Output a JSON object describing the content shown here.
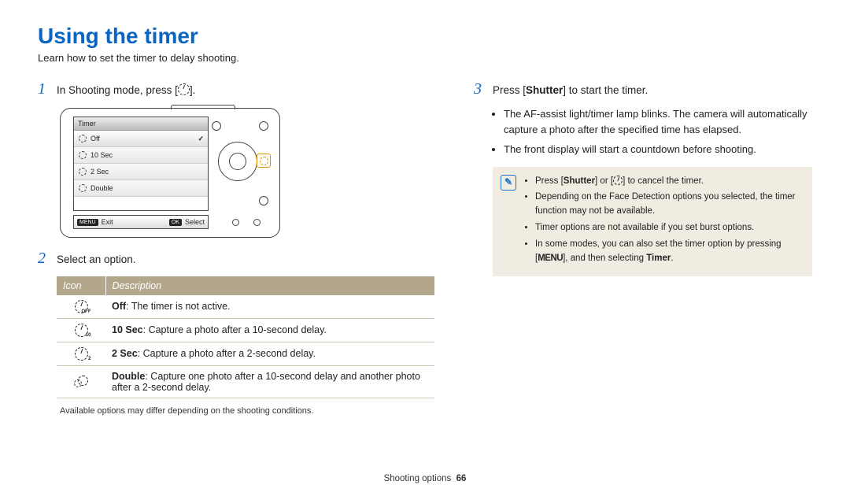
{
  "title": "Using the timer",
  "intro": "Learn how to set the timer to delay shooting.",
  "steps": {
    "s1_num": "1",
    "s1_prefix": "In Shooting mode, press [",
    "s1_suffix": "].",
    "s2_num": "2",
    "s2_text": "Select an option.",
    "s3_num": "3",
    "s3_prefix": "Press [",
    "s3_bold": "Shutter",
    "s3_suffix": "] to start the timer."
  },
  "camera_screen": {
    "title": "Timer",
    "options": [
      "Off",
      "10 Sec",
      "2 Sec",
      "Double"
    ],
    "footer_left_btn": "MENU",
    "footer_left": "Exit",
    "footer_right_btn": "OK",
    "footer_right": "Select"
  },
  "table": {
    "header_icon": "Icon",
    "header_desc": "Description",
    "rows": [
      {
        "label": "Off",
        "desc": ": The timer is not active."
      },
      {
        "label": "10 Sec",
        "desc": ": Capture a photo after a 10-second delay."
      },
      {
        "label": "2 Sec",
        "desc": ": Capture a photo after a 2-second delay."
      },
      {
        "label": "Double",
        "desc": ": Capture one photo after a 10-second delay and another photo after a 2-second delay."
      }
    ]
  },
  "footnote": "Available options may differ depending on the shooting conditions.",
  "right_bullets": [
    "The AF-assist light/timer lamp blinks. The camera will automatically capture a photo after the specified time has elapsed.",
    "The front display will start a countdown before shooting."
  ],
  "note": {
    "n1_prefix": "Press [",
    "n1_bold": "Shutter",
    "n1_mid": "] or [",
    "n1_suffix": "] to cancel the timer.",
    "n2": "Depending on the Face Detection options you selected, the timer function may not be available.",
    "n3": "Timer options are not available if you set burst options.",
    "n4_prefix": "In some modes, you can also set the timer option by pressing [",
    "n4_menu": "MENU",
    "n4_mid": "], and then selecting ",
    "n4_bold": "Timer",
    "n4_suffix": "."
  },
  "footer": {
    "section": "Shooting options",
    "page": "66"
  }
}
